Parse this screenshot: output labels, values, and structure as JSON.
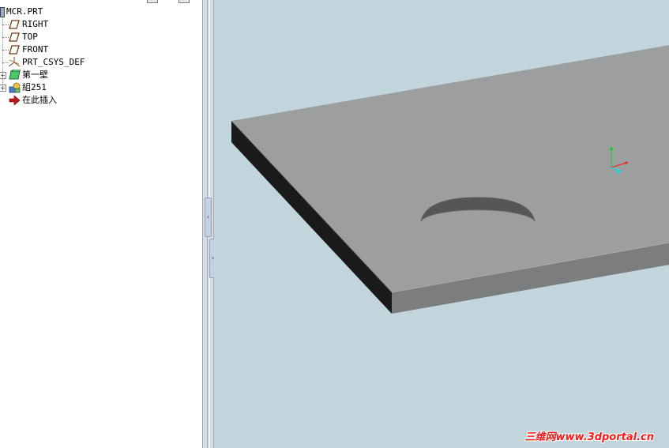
{
  "model_tree": {
    "root": "MCR.PRT",
    "items": [
      {
        "label": "RIGHT",
        "icon": "datum-plane-icon"
      },
      {
        "label": "TOP",
        "icon": "datum-plane-icon"
      },
      {
        "label": "FRONT",
        "icon": "datum-plane-icon"
      },
      {
        "label": "PRT_CSYS_DEF",
        "icon": "coordinate-system-icon"
      },
      {
        "label": "第一壁",
        "icon": "sheetmetal-wall-icon",
        "expander": "+"
      },
      {
        "label": "組251",
        "icon": "group-icon",
        "expander": "+"
      },
      {
        "label": "在此插入",
        "icon": "insert-here-arrow-icon"
      }
    ]
  },
  "splitter": {
    "collapse_glyph": "‹",
    "expand_glyph": "›"
  },
  "viewport": {
    "background": "#c2d5dc",
    "model": "sheet-metal plate with circular cut",
    "watermark": "三维网www.3dportal.cn",
    "csys_colors": {
      "x": "#e03030",
      "y": "#30c040",
      "z": "#20d8d8"
    }
  }
}
